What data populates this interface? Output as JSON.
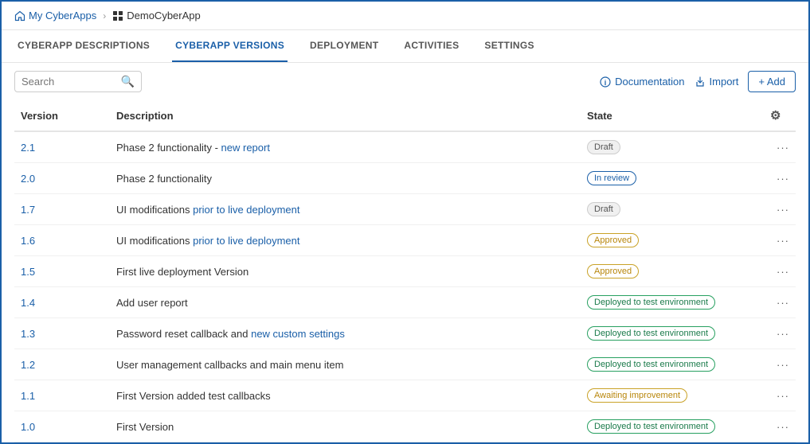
{
  "breadcrumb": {
    "home_label": "My CyberApps",
    "current_label": "DemoCyberApp"
  },
  "tabs": [
    {
      "id": "descriptions",
      "label": "CYBERAPP DESCRIPTIONS",
      "active": false
    },
    {
      "id": "versions",
      "label": "CYBERAPP VERSIONS",
      "active": true
    },
    {
      "id": "deployment",
      "label": "DEPLOYMENT",
      "active": false
    },
    {
      "id": "activities",
      "label": "ACTIVITIES",
      "active": false
    },
    {
      "id": "settings",
      "label": "SETTINGS",
      "active": false
    }
  ],
  "toolbar": {
    "search_placeholder": "Search",
    "documentation_label": "Documentation",
    "import_label": "Import",
    "add_label": "+ Add"
  },
  "table": {
    "columns": [
      {
        "id": "version",
        "label": "Version"
      },
      {
        "id": "description",
        "label": "Description"
      },
      {
        "id": "state",
        "label": "State"
      },
      {
        "id": "actions",
        "label": ""
      }
    ],
    "rows": [
      {
        "version": "2.1",
        "description": "Phase 2 functionality - new report",
        "state": "Draft",
        "state_type": "draft"
      },
      {
        "version": "2.0",
        "description": "Phase 2 functionality",
        "state": "In review",
        "state_type": "inreview"
      },
      {
        "version": "1.7",
        "description": "UI modifications prior to live deployment",
        "state": "Draft",
        "state_type": "draft"
      },
      {
        "version": "1.6",
        "description": "UI modifications prior to live deployment",
        "state": "Approved",
        "state_type": "approved"
      },
      {
        "version": "1.5",
        "description": "First live deployment Version",
        "state": "Approved",
        "state_type": "approved"
      },
      {
        "version": "1.4",
        "description": "Add user report",
        "state": "Deployed to test environment",
        "state_type": "deployed"
      },
      {
        "version": "1.3",
        "description": "Password reset callback and new custom settings",
        "state": "Deployed to test environment",
        "state_type": "deployed"
      },
      {
        "version": "1.2",
        "description": "User management callbacks and main menu item",
        "state": "Deployed to test environment",
        "state_type": "deployed"
      },
      {
        "version": "1.1",
        "description": "First Version added test callbacks",
        "state": "Awaiting improvement",
        "state_type": "awaiting"
      },
      {
        "version": "1.0",
        "description": "First Version",
        "state": "Deployed to test environment",
        "state_type": "deployed"
      }
    ]
  }
}
